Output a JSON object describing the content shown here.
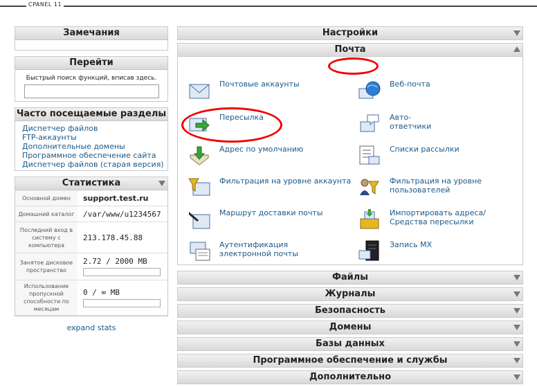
{
  "header": {
    "logo": "CPANEL 11"
  },
  "left": {
    "notes_title": "Замечания",
    "goto": {
      "title": "Перейти",
      "hint": "Быстрый поиск функций, вписав здесь.",
      "search_value": ""
    },
    "frequent": {
      "title": "Часто посещаемые разделы",
      "items": [
        "Диспетчер файлов",
        "FTP-аккаунты",
        "Дополнительные домены",
        "Программное обеспечение сайта",
        "Диспетчер файлов (старая версия)"
      ]
    },
    "stats": {
      "title": "Статистика",
      "rows": [
        {
          "label": "Основной домен",
          "value": "support.test.ru"
        },
        {
          "label": "Домашний каталог",
          "value": "/var/www/u1234567"
        },
        {
          "label": "Последний вход в систему с компьютера",
          "value": "213.178.45.88"
        },
        {
          "label": "Занятое дисковое пространство",
          "value": "2.72 / 2000 MB"
        },
        {
          "label": "Использование пропускной способности по месяцам",
          "value": "0 / ∞ MB"
        }
      ],
      "expand": "expand stats"
    }
  },
  "right": {
    "settings": "Настройки",
    "mail": {
      "title": "Почта",
      "items": [
        {
          "label": "Почтовые аккаунты",
          "icon": "envelope-icon"
        },
        {
          "label": "Веб-почта",
          "icon": "webmail-globe-icon"
        },
        {
          "label": "Пересылка",
          "icon": "forward-arrow-icon"
        },
        {
          "label": "Авто-ответчики",
          "icon": "autoresponder-icon"
        },
        {
          "label": "Адрес по умолчанию",
          "icon": "default-address-icon"
        },
        {
          "label": "Списки рассылки",
          "icon": "mailing-list-icon"
        },
        {
          "label": "Фильтрация на уровне аккаунта",
          "icon": "account-filter-icon"
        },
        {
          "label": "Фильтрация на уровне пользователей",
          "icon": "user-filter-icon"
        },
        {
          "label": "Маршрут доставки почты",
          "icon": "delivery-route-icon"
        },
        {
          "label": "Импортировать адреса/Средства пересылки",
          "icon": "import-icon"
        },
        {
          "label": "Аутентификация электронной почты",
          "icon": "authentication-icon"
        },
        {
          "label": "Запись MX",
          "icon": "mx-server-icon"
        }
      ]
    },
    "sections": [
      "Файлы",
      "Журналы",
      "Безопасность",
      "Домены",
      "Базы данных",
      "Программное обеспечение и службы",
      "Дополнительно"
    ]
  }
}
